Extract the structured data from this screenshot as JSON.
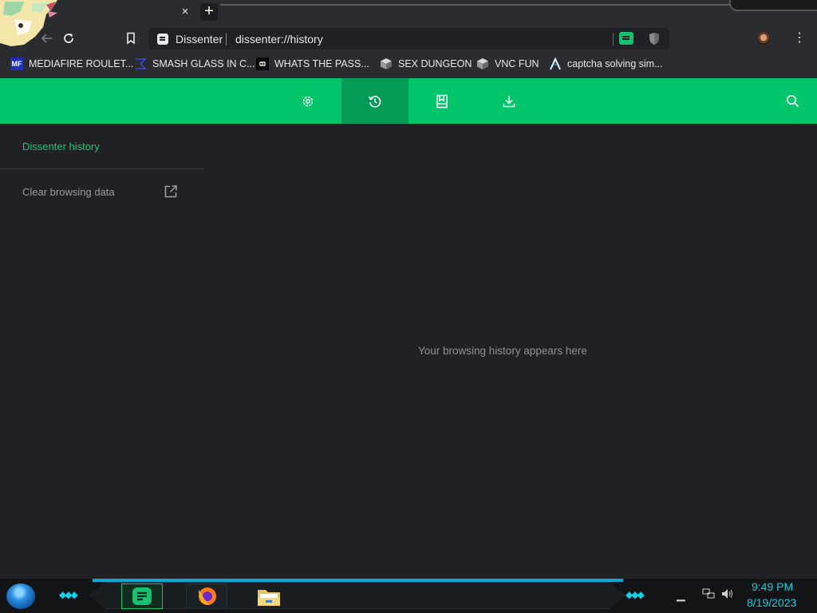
{
  "browser": {
    "tab_close_glyph": "×",
    "new_tab_glyph": "+",
    "omnibox": {
      "site_name": "Dissenter",
      "url": "dissenter://history"
    },
    "menu_glyph": "⋮",
    "accent_color": "#00c56a",
    "active_tab_color": "#049a58"
  },
  "bookmarks": [
    {
      "label": "MEDIAFIRE ROULET...",
      "icon": "mediafire-icon"
    },
    {
      "label": "SMASH GLASS IN C...",
      "icon": "sigma-icon"
    },
    {
      "label": "WHATS THE PASS...",
      "icon": "discord-icon"
    },
    {
      "label": "SEX DUNGEON",
      "icon": "cube-icon"
    },
    {
      "label": "VNC FUN",
      "icon": "cube-icon"
    },
    {
      "label": "captcha solving sim...",
      "icon": "lambda-icon"
    }
  ],
  "nav": {
    "icons": [
      "settings-icon",
      "history-icon",
      "bookmarks-icon",
      "download-icon"
    ],
    "active": "history-icon",
    "search_icon": "search-icon"
  },
  "sidebar": {
    "title": "Dissenter history",
    "link": "Clear browsing data"
  },
  "main": {
    "empty_message": "Your browsing history appears here"
  },
  "taskbar": {
    "time": "9:49 PM",
    "date": "8/19/2023"
  }
}
